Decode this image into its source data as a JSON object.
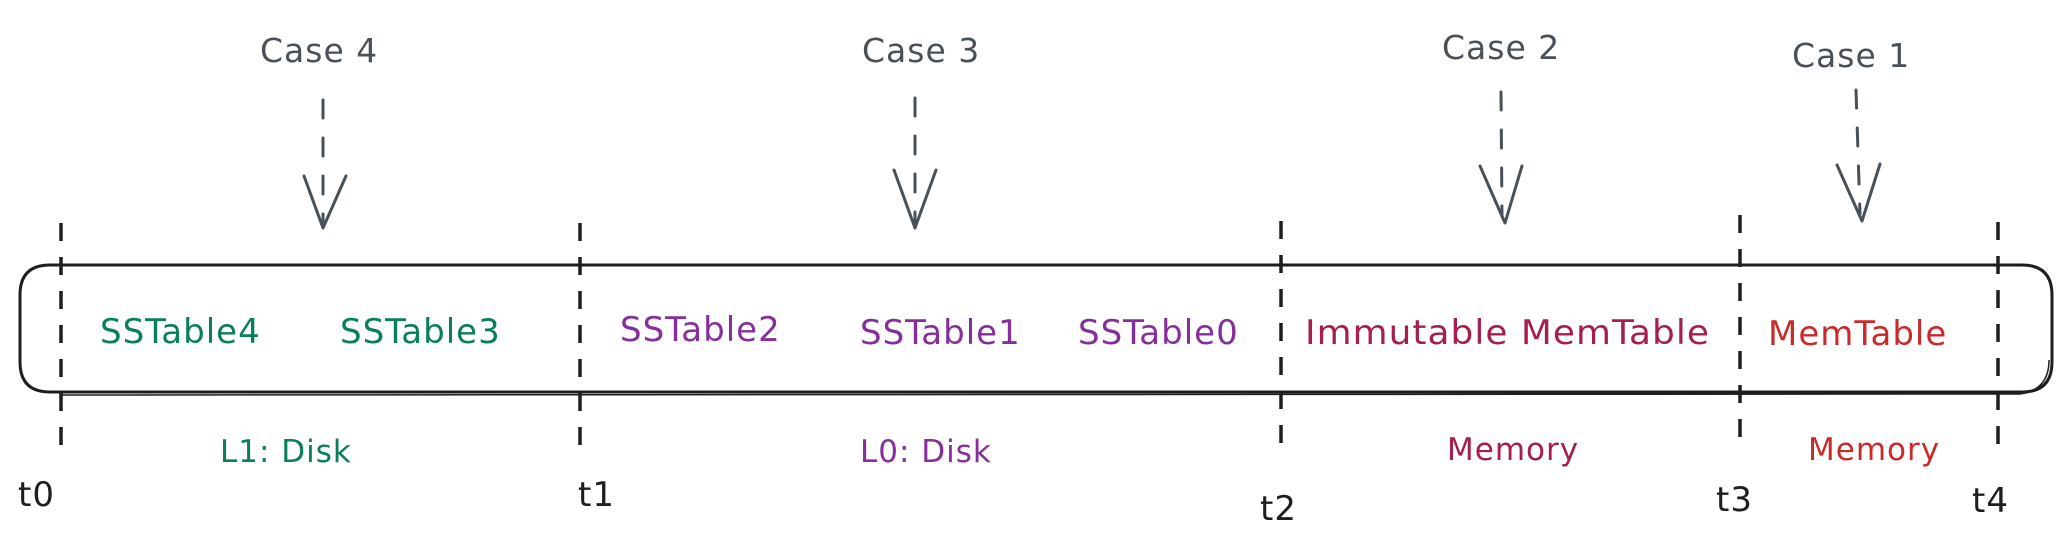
{
  "colors": {
    "case": "#495057",
    "l1_disk": "#087f5b",
    "l0_disk": "#862e9c",
    "immutable_memory": "#a61e4d",
    "memory": "#c92a2a",
    "timeline": "#1e1e1e"
  },
  "cases": [
    {
      "id": "case4",
      "label": "Case 4"
    },
    {
      "id": "case3",
      "label": "Case 3"
    },
    {
      "id": "case2",
      "label": "Case 2"
    },
    {
      "id": "case1",
      "label": "Case 1"
    }
  ],
  "tables": [
    {
      "id": "sstable4",
      "label": "SSTable4",
      "tier": "l1_disk"
    },
    {
      "id": "sstable3",
      "label": "SSTable3",
      "tier": "l1_disk"
    },
    {
      "id": "sstable2",
      "label": "SSTable2",
      "tier": "l0_disk"
    },
    {
      "id": "sstable1",
      "label": "SSTable1",
      "tier": "l0_disk"
    },
    {
      "id": "sstable0",
      "label": "SSTable0",
      "tier": "l0_disk"
    },
    {
      "id": "immutable-memtable",
      "label": "Immutable MemTable",
      "tier": "immutable_memory"
    },
    {
      "id": "memtable",
      "label": "MemTable",
      "tier": "memory"
    }
  ],
  "tiers": [
    {
      "id": "l1_disk",
      "label": "L1: Disk"
    },
    {
      "id": "l0_disk",
      "label": "L0: Disk"
    },
    {
      "id": "immutable_memory",
      "label": "Memory"
    },
    {
      "id": "memory",
      "label": "Memory"
    }
  ],
  "time_marks": [
    "t0",
    "t1",
    "t2",
    "t3",
    "t4"
  ]
}
